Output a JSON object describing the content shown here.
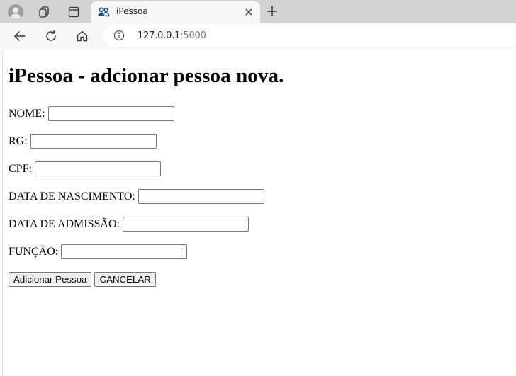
{
  "browser": {
    "tab": {
      "title": "iPessoa",
      "close_label": "×"
    },
    "address_bar": {
      "host": "127.0.0.1",
      "port": ":5000"
    }
  },
  "page": {
    "title": "iPessoa - adcionar pessoa nova.",
    "fields": {
      "nome": {
        "label": "NOME:",
        "value": ""
      },
      "rg": {
        "label": "RG:",
        "value": ""
      },
      "cpf": {
        "label": "CPF:",
        "value": ""
      },
      "data_nascimento": {
        "label": "DATA DE NASCIMENTO:",
        "value": ""
      },
      "data_admissao": {
        "label": "DATA DE ADMISSÃO:",
        "value": ""
      },
      "funcao": {
        "label": "FUNÇÃO:",
        "value": ""
      }
    },
    "buttons": {
      "add": "Adicionar Pessoa",
      "cancel": "CANCELAR"
    }
  }
}
